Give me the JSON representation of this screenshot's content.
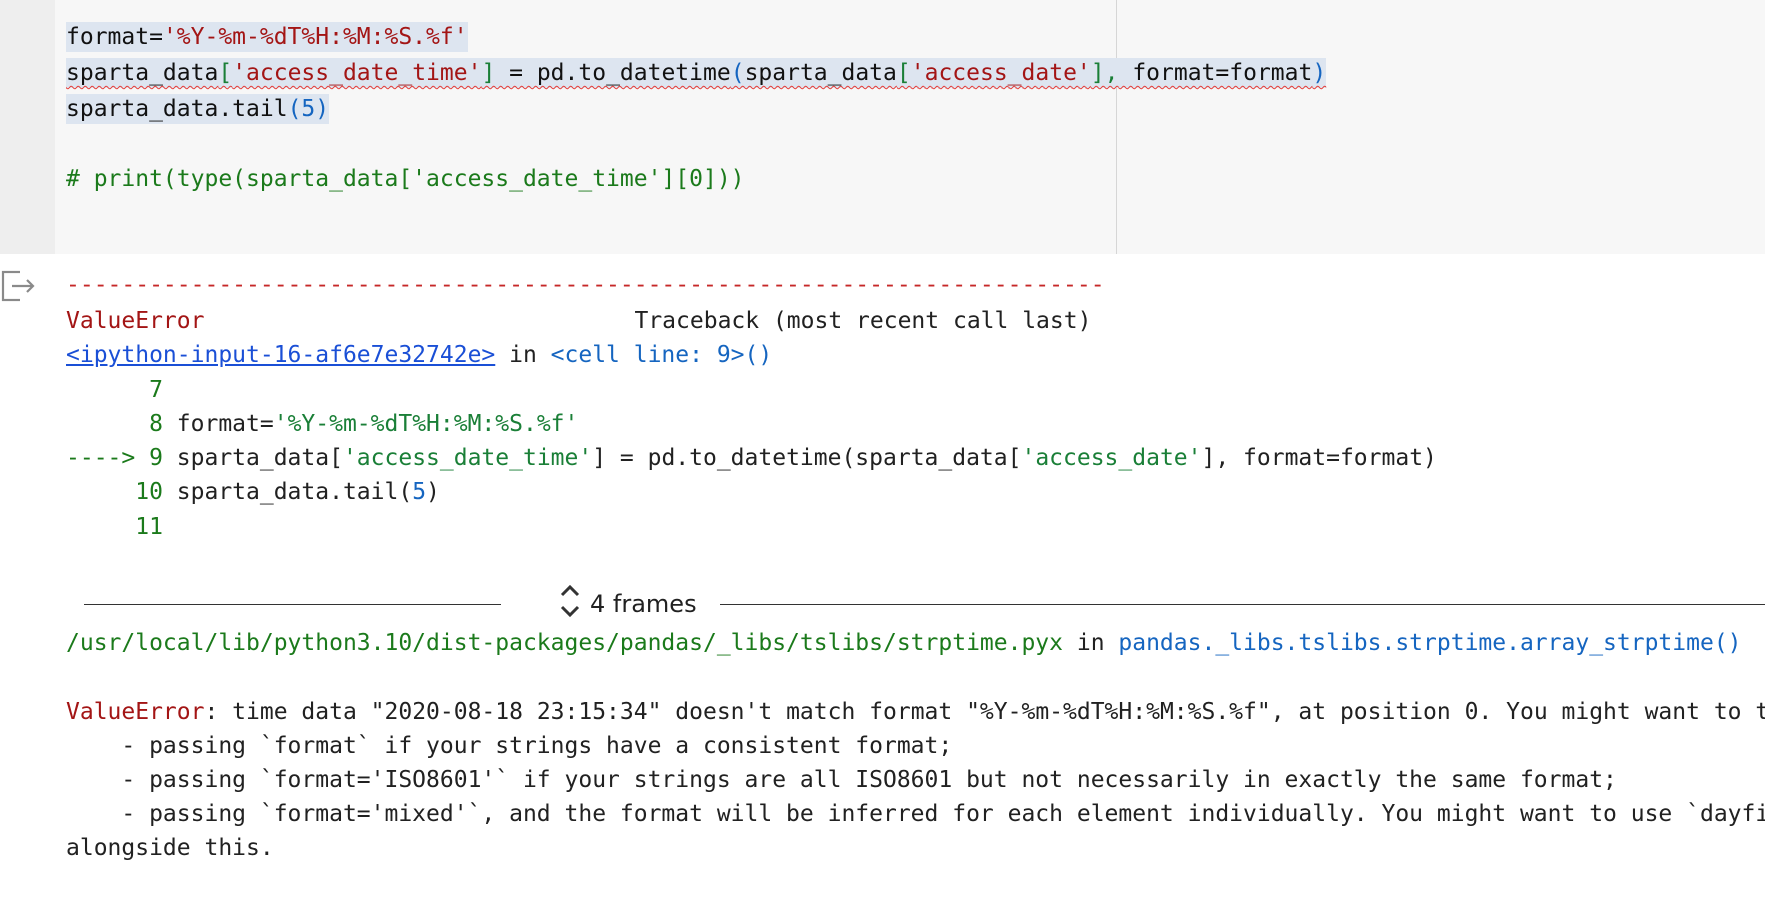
{
  "code": {
    "line1": {
      "a": "format=",
      "b": "'%Y-%m-%dT%H:%M:%S.%f'"
    },
    "line2": {
      "a": "sparta_data",
      "b": "[",
      "c": "'access_date_time'",
      "d": "]",
      "e": " = pd.to_datetime",
      "f": "(",
      "g": "sparta_data",
      "h": "[",
      "i": "'access_date'",
      "j": "],",
      "k": " format=format",
      "l": ")"
    },
    "line3": {
      "a": "sparta_data.tail",
      "b": "(",
      "c": "5",
      "d": ")"
    },
    "line5": "# print(type(sparta_data['access_date_time'][0]))"
  },
  "output": {
    "dash_line": "---------------------------------------------------------------------------",
    "error_name": "ValueError",
    "traceback_header": "Traceback (most recent call last)",
    "input_link": "<ipython-input-16-af6e7e32742e>",
    "in_word": " in ",
    "cell_line": "<cell line: 9>",
    "cell_line_paren": "()",
    "tb_lines": [
      {
        "prefix": "      7",
        "code": ""
      },
      {
        "prefix": "      8 ",
        "code_a": "format=",
        "code_b": "'%Y-%m-%dT%H:%M:%S.%f'"
      },
      {
        "prefix": "----> 9 ",
        "code_a": "sparta_data[",
        "code_b": "'access_date_time'",
        "code_c": "] = pd.to_datetime(sparta_data[",
        "code_d": "'access_date'",
        "code_e": "], format=format)"
      },
      {
        "prefix": "     10 ",
        "code_a": "sparta_data.tail(",
        "code_b": "5",
        "code_c": ")"
      },
      {
        "prefix": "     11",
        "code": ""
      }
    ],
    "frames_label": "4 frames",
    "lib_path": "/usr/local/lib/python3.10/dist-packages/pandas/_libs/tslibs/strptime.pyx",
    "lib_in": " in ",
    "lib_func": "pandas._libs.tslibs.strptime.array_strptime()",
    "final_error": "ValueError",
    "final_msg": ": time data \"2020-08-18 23:15:34\" doesn't match format \"%Y-%m-%dT%H:%M:%S.%f\", at position 0. You might want to try:",
    "hint1": "    - passing `format` if your strings have a consistent format;",
    "hint2": "    - passing `format='ISO8601'` if your strings are all ISO8601 but not necessarily in exactly the same format;",
    "hint3": "    - passing `format='mixed'`, and the format will be inferred for each element individually. You might want to use `dayfirst`",
    "hint4": "alongside this."
  },
  "icons": {
    "output_icon": "output-redirect-icon",
    "frames_icon": "expand-collapse-icon"
  }
}
